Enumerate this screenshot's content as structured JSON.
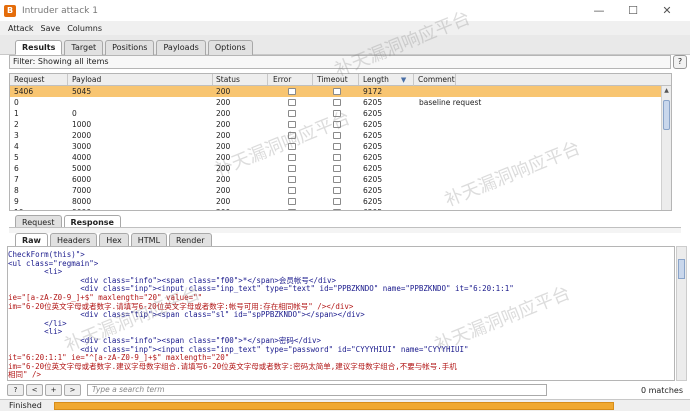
{
  "window": {
    "title": "Intruder attack 1",
    "controls": [
      "—",
      "☐",
      "✕"
    ]
  },
  "menu": [
    "Attack",
    "Save",
    "Columns"
  ],
  "main_tabs": [
    "Results",
    "Target",
    "Positions",
    "Payloads",
    "Options"
  ],
  "filter": {
    "text": "Filter: Showing all items",
    "help": "?"
  },
  "table": {
    "headers": [
      "Request",
      "Payload",
      "Status",
      "Error",
      "Timeout",
      "Length",
      "Comment"
    ],
    "rows": [
      {
        "request": "5406",
        "payload": "5045",
        "status": "200",
        "length": "9172",
        "comment": ""
      },
      {
        "request": "0",
        "payload": "",
        "status": "200",
        "length": "6205",
        "comment": "baseline request"
      },
      {
        "request": "1",
        "payload": "0",
        "status": "200",
        "length": "6205",
        "comment": ""
      },
      {
        "request": "2",
        "payload": "1000",
        "status": "200",
        "length": "6205",
        "comment": ""
      },
      {
        "request": "3",
        "payload": "2000",
        "status": "200",
        "length": "6205",
        "comment": ""
      },
      {
        "request": "4",
        "payload": "3000",
        "status": "200",
        "length": "6205",
        "comment": ""
      },
      {
        "request": "5",
        "payload": "4000",
        "status": "200",
        "length": "6205",
        "comment": ""
      },
      {
        "request": "6",
        "payload": "5000",
        "status": "200",
        "length": "6205",
        "comment": ""
      },
      {
        "request": "7",
        "payload": "6000",
        "status": "200",
        "length": "6205",
        "comment": ""
      },
      {
        "request": "8",
        "payload": "7000",
        "status": "200",
        "length": "6205",
        "comment": ""
      },
      {
        "request": "9",
        "payload": "8000",
        "status": "200",
        "length": "6205",
        "comment": ""
      },
      {
        "request": "10",
        "payload": "9000",
        "status": "200",
        "length": "6205",
        "comment": ""
      }
    ]
  },
  "reqresp_tabs": [
    "Request",
    "Response"
  ],
  "view_tabs": [
    "Raw",
    "Headers",
    "Hex",
    "HTML",
    "Render"
  ],
  "code_lines": [
    "CheckForm(this)\">",
    "<ul class=\"regmain\">",
    "        <li>",
    "                <div class=\"info\"><span class=\"f00\">*</span>会员帐号</div>",
    "                <div class=\"inp\"><input class=\"inp_text\" type=\"text\" id=\"PPBZKNDO\" name=\"PPBZKNDO\" it=\"6:20:1:1\"",
    "ie=\"[a-zA-Z0-9_]+$\" maxlength=\"20\" value=\"\"",
    "im=\"6-20位英文字母或者数字.请填写6-20位英文字母或者数字:帐号可用:存在相同帐号\" /></div>",
    "                <div class=\"tip\"><span class=\"sl\" id=\"spPPBZKNDO\"></span></div>",
    "        </li>",
    "        <li>",
    "                <div class=\"info\"><span class=\"f00\">*</span>密码</div>",
    "                <div class=\"inp\"><input class=\"inp_text\" type=\"password\" id=\"CYYYHIUI\" name=\"CYYYHIUI\"",
    "it=\"6:20:1:1\" ie=\"^[a-zA-Z0-9_]+$\" maxlength=\"20\"",
    "im=\"6-20位英文字母或者数字.建议字母数字组合.请填写6-20位英文字母或者数字:密码太简单,建议字母数字组合,不要与帐号.手机",
    "相同\" />"
  ],
  "search": {
    "buttons": [
      "?",
      "<",
      "+",
      ">"
    ],
    "placeholder": "Type a search term",
    "matches": "0 matches"
  },
  "status": {
    "text": "Finished",
    "progress": 1.0
  },
  "watermark": "补天漏洞响应平台",
  "colors": {
    "selected_row": "#f8c571",
    "progress": "#f0a830",
    "code": "#1a1a8c"
  }
}
